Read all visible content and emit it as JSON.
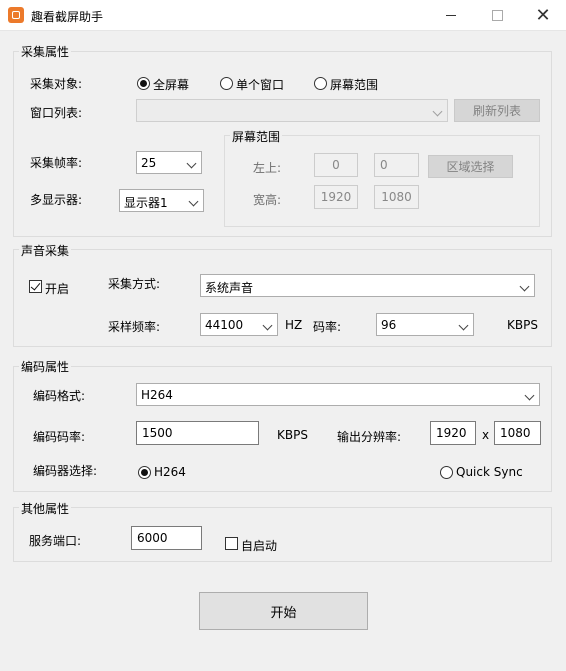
{
  "window": {
    "title": "趣看截屏助手",
    "app_icon": "recorder-app-icon",
    "minimize": "minimize-icon",
    "maximize": "maximize-icon",
    "close": "close-icon",
    "close_glyph": "✕"
  },
  "capture": {
    "section_title": "采集属性",
    "target_label": "采集对象:",
    "target_options": [
      "全屏幕",
      "单个窗口",
      "屏幕范围"
    ],
    "target_selected": "全屏幕",
    "window_list_label": "窗口列表:",
    "window_list_value": "",
    "refresh_button": "刷新列表",
    "fps_label": "采集帧率:",
    "fps_value": "25",
    "display_label": "多显示器:",
    "display_value": "显示器1",
    "screen_range": {
      "title": "屏幕范围",
      "topleft_label": "左上:",
      "left_value": "0",
      "top_value": "0",
      "select_button": "区域选择",
      "size_label": "宽高:",
      "width_value": "1920",
      "height_value": "1080"
    }
  },
  "audio": {
    "section_title": "声音采集",
    "enable_label": "开启",
    "enabled": true,
    "method_label": "采集方式:",
    "method_value": "系统声音",
    "samplerate_label": "采样频率:",
    "samplerate_value": "44100",
    "samplerate_unit": "HZ",
    "bitrate_label": "码率:",
    "bitrate_value": "96",
    "bitrate_unit": "KBPS"
  },
  "encoding": {
    "section_title": "编码属性",
    "format_label": "编码格式:",
    "format_value": "H264",
    "bitrate_label": "编码码率:",
    "bitrate_value": "1500",
    "bitrate_unit": "KBPS",
    "resolution_label": "输出分辨率:",
    "res_width": "1920",
    "res_sep": "x",
    "res_height": "1080",
    "encoder_label": "编码器选择:",
    "encoder_options": [
      "H264",
      "Quick Sync"
    ],
    "encoder_selected": "H264"
  },
  "other": {
    "section_title": "其他属性",
    "port_label": "服务端口:",
    "port_value": "6000",
    "autostart_label": "自启动",
    "autostart": false
  },
  "start_button": "开始"
}
